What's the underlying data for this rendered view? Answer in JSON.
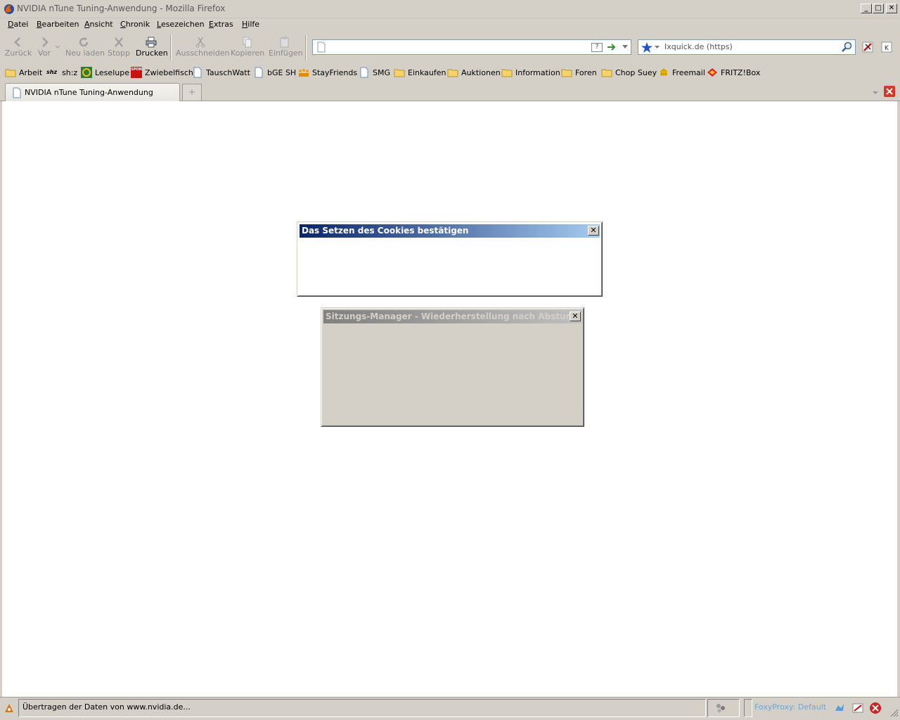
{
  "window": {
    "title": "NVIDIA nTune Tuning-Anwendung - Mozilla Firefox",
    "minimize_glyph": "_",
    "maximize_glyph": "□",
    "close_glyph": "✕"
  },
  "menu": {
    "items": [
      {
        "first": "D",
        "rest": "atei"
      },
      {
        "first": "B",
        "rest": "earbeiten"
      },
      {
        "first": "A",
        "rest": "nsicht"
      },
      {
        "first": "C",
        "rest": "hronik"
      },
      {
        "first": "L",
        "rest": "esezeichen"
      },
      {
        "first": "E",
        "rest": "xtras"
      },
      {
        "first": "H",
        "rest": "ilfe"
      }
    ]
  },
  "toolbar": {
    "back": "Zurück",
    "forward": "Vor",
    "reload": "Neu laden",
    "stop": "Stopp",
    "print": "Drucken",
    "cut": "Ausschneiden",
    "copy": "Kopieren",
    "paste": "Einfügen"
  },
  "url": {
    "value": "",
    "help_glyph": "?"
  },
  "search": {
    "engine": "Ixquick.de (https)"
  },
  "bookmarks": [
    {
      "label": "Arbeit",
      "icon": "folder-icon"
    },
    {
      "label": "sh:z",
      "icon": "shz-logo-icon",
      "logo_text": "shz"
    },
    {
      "label": "Leselupe",
      "icon": "leselupe-icon"
    },
    {
      "label": "Zwiebelfisch",
      "icon": "spon-icon",
      "logo_text": "SPON"
    },
    {
      "label": "TauschWatt",
      "icon": "page-icon"
    },
    {
      "label": "bGE SH",
      "icon": "page-icon"
    },
    {
      "label": "StayFriends",
      "icon": "stayfriends-icon"
    },
    {
      "label": "SMG",
      "icon": "page-icon"
    },
    {
      "label": "Einkaufen",
      "icon": "folder-icon"
    },
    {
      "label": "Auktionen",
      "icon": "folder-icon"
    },
    {
      "label": "Information",
      "icon": "folder-icon"
    },
    {
      "label": "Foren",
      "icon": "folder-icon"
    },
    {
      "label": "Chop Suey",
      "icon": "folder-icon"
    },
    {
      "label": "Freemail",
      "icon": "freemail-icon"
    },
    {
      "label": "FRITZ!Box",
      "icon": "fritzbox-icon"
    }
  ],
  "tabs": [
    {
      "label": "NVIDIA nTune Tuning-Anwendung",
      "active": true
    }
  ],
  "dialogs": {
    "cookies": {
      "title": "Das Setzen des Cookies bestätigen",
      "close_glyph": "✕"
    },
    "session": {
      "title": "Sitzungs-Manager - Wiederherstellung nach Absturz",
      "close_glyph": "✕"
    }
  },
  "status": {
    "text": "Übertragen der Daten von www.nvidia.de...",
    "foxyproxy": "FoxyProxy: Default"
  },
  "colors": {
    "active_title_gradient": [
      "#0a246a",
      "#a6caf0"
    ],
    "inactive_title_gradient": [
      "#808080",
      "#c0c0c0"
    ],
    "chrome": "#d4d0c8",
    "foxyproxy_text": "#6aa6d8"
  }
}
